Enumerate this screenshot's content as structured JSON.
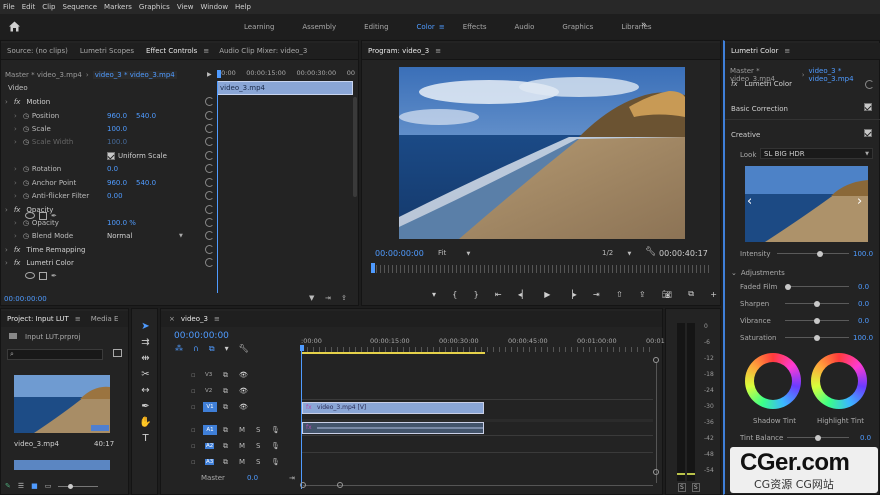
{
  "menu": [
    "File",
    "Edit",
    "Clip",
    "Sequence",
    "Markers",
    "Graphics",
    "View",
    "Window",
    "Help"
  ],
  "workspaces": {
    "items": [
      "Learning",
      "Assembly",
      "Editing",
      "Color",
      "Effects",
      "Audio",
      "Graphics",
      "Libraries"
    ],
    "active": "Color",
    "more": "»"
  },
  "source_panel": {
    "tabs": [
      "Source: (no clips)",
      "Lumetri Scopes",
      "Effect Controls",
      "Audio Clip Mixer: video_3"
    ],
    "master_label": "Master * video_3.mp4",
    "clip_label": "video_3 * video_3.mp4",
    "ruler": [
      "00:00",
      "00:00:15:00",
      "00:00:30:00",
      "00"
    ],
    "clip_bar": "video_3.mp4",
    "section": "Video",
    "effects": [
      {
        "name": "Motion",
        "type": "fx"
      },
      {
        "name": "Position",
        "v1": "960.0",
        "v2": "540.0"
      },
      {
        "name": "Scale",
        "v1": "100.0"
      },
      {
        "name": "Scale Width",
        "v1": "100.0",
        "dim": true
      },
      {
        "name": "Uniform Scale",
        "check": true
      },
      {
        "name": "Rotation",
        "v1": "0.0"
      },
      {
        "name": "Anchor Point",
        "v1": "960.0",
        "v2": "540.0"
      },
      {
        "name": "Anti-flicker Filter",
        "v1": "0.00"
      },
      {
        "name": "Opacity",
        "type": "fx"
      },
      {
        "name": "Opacity",
        "v1": "100.0 %"
      },
      {
        "name": "Blend Mode",
        "v1": "Normal",
        "dropdown": true
      },
      {
        "name": "Time Remapping",
        "type": "fx"
      },
      {
        "name": "Lumetri Color",
        "type": "fx"
      }
    ],
    "timecode": "00:00:00:00"
  },
  "program": {
    "title": "Program: video_3",
    "timecode_left": "00:00:00:00",
    "fit": "Fit",
    "ratio": "1/2",
    "timecode_right": "00:00:40:17"
  },
  "project": {
    "tabs": [
      "Project: Input LUT",
      "Media E"
    ],
    "file": "Input LUT.prproj",
    "clip_name": "video_3.mp4",
    "clip_dur": "40:17"
  },
  "timeline": {
    "title": "video_3",
    "timecode": "00:00:00:00",
    "ruler": [
      ":00:00",
      "00:00:15:00",
      "00:00:30:00",
      "00:00:45:00",
      "00:01:00:00",
      "00:01:15"
    ],
    "video_tracks": [
      "V3",
      "V2",
      "V1"
    ],
    "audio_tracks": [
      "A1",
      "A2",
      "A3"
    ],
    "master": "Master",
    "master_val": "0.0",
    "video_clip": "video_3.mp4 [V]",
    "db_scale": [
      "0",
      "-6",
      "-12",
      "-18",
      "-24",
      "-30",
      "-36",
      "-42",
      "-48",
      "-54"
    ],
    "solo": "S"
  },
  "lumetri": {
    "title": "Lumetri Color",
    "master_label": "Master * video_3.mp4",
    "clip_label": "video_3 * video_3.mp4",
    "fx_name": "Lumetri Color",
    "basic": "Basic Correction",
    "creative": "Creative",
    "look_label": "Look",
    "look_value": "SL BIG HDR",
    "intensity_label": "Intensity",
    "intensity": "100.0",
    "adjustments": "Adjustments",
    "sliders": [
      {
        "label": "Faded Film",
        "value": "0.0",
        "pos": 0
      },
      {
        "label": "Sharpen",
        "value": "0.0",
        "pos": 0.5
      },
      {
        "label": "Vibrance",
        "value": "0.0",
        "pos": 0.5
      },
      {
        "label": "Saturation",
        "value": "100.0",
        "pos": 0.5
      }
    ],
    "shadow_tint": "Shadow Tint",
    "highlight_tint": "Highlight Tint",
    "tint_balance": "Tint Balance",
    "tint_balance_value": "0.0"
  },
  "watermark": {
    "main": "CGer.com",
    "sub": "CG资源 CG网站"
  }
}
